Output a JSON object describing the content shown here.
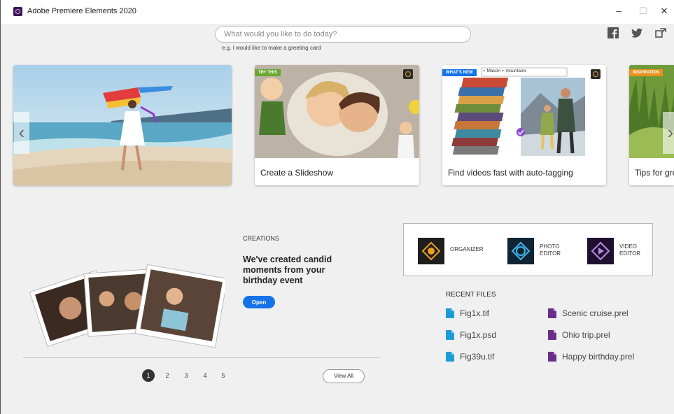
{
  "window": {
    "title": "Adobe Premiere Elements 2020",
    "controls": {
      "minimize": "–",
      "maximize": "☐",
      "close": "✕"
    }
  },
  "search": {
    "placeholder": "What would you like to do today?",
    "hint": "e.g. I would like to make a greeting card"
  },
  "social": [
    "facebook-icon",
    "twitter-icon",
    "share-icon"
  ],
  "carousel": {
    "cards": [
      {
        "badge": "",
        "caption": ""
      },
      {
        "badge": "TRY THIS",
        "caption": "Create a Slideshow"
      },
      {
        "badge": "WHAT'S NEW",
        "caption": "Find videos fast with auto-tagging",
        "search_text": "Mason + mountains"
      },
      {
        "badge": "INSPIRATION",
        "caption": "Tips for gre"
      }
    ],
    "prev_icon": "‹",
    "next_icon": "›"
  },
  "creations": {
    "label": "CREATIONS",
    "headline": "We've created candid moments from your birthday event",
    "open_label": "Open"
  },
  "pagination": {
    "pages": [
      "1",
      "2",
      "3",
      "4",
      "5"
    ],
    "active": "1",
    "view_all": "View All"
  },
  "launchers": [
    {
      "label": "ORGANIZER"
    },
    {
      "label": "PHOTO\nEDITOR"
    },
    {
      "label": "VIDEO\nEDITOR"
    }
  ],
  "recent": {
    "title": "RECENT FILES",
    "files_left": [
      "Fig1x.tif",
      "Fig1x.psd",
      "Fig39u.tif"
    ],
    "files_right": [
      "Scenic cruise.prel",
      "Ohio trip.prel",
      "Happy birthday.prel"
    ]
  },
  "colors": {
    "accent": "#1473e6",
    "try_this": "#6aa72d",
    "whats_new": "#1473e6",
    "inspiration": "#e8921e",
    "photoshop_file": "#1d9bd7",
    "premiere_file": "#6b2d8a"
  }
}
